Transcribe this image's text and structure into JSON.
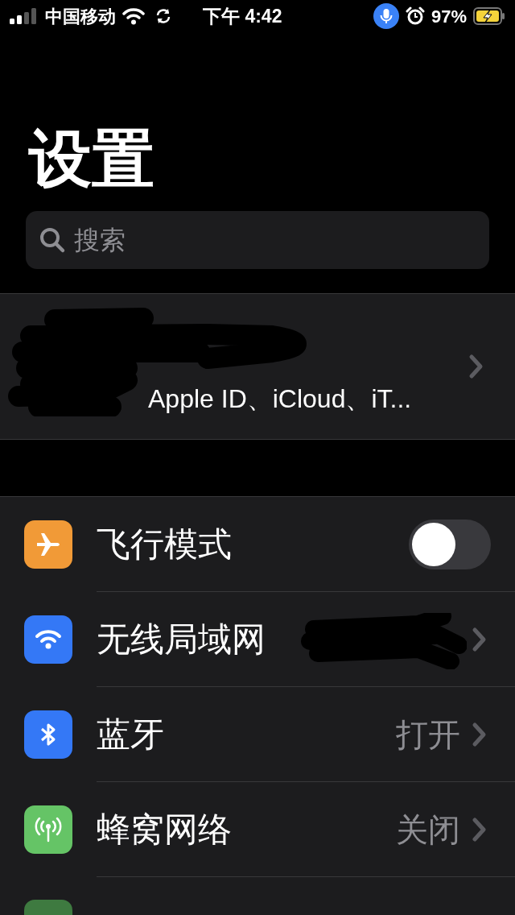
{
  "status_bar": {
    "carrier": "中国移动",
    "time": "下午 4:42",
    "battery": "97%",
    "charging": true
  },
  "title": "设置",
  "search": {
    "placeholder": "搜索"
  },
  "profile": {
    "subtitle": "Apple ID、iCloud、iT..."
  },
  "settings": [
    {
      "kind": "toggle",
      "label": "飞行模式",
      "on": false,
      "color": "#f19a37"
    },
    {
      "kind": "link",
      "label": "无线局域网",
      "color": "#3478f6"
    },
    {
      "kind": "link",
      "label": "蓝牙",
      "value": "打开",
      "color": "#3478f6"
    },
    {
      "kind": "link",
      "label": "蜂窝网络",
      "value": "关闭",
      "color": "#65c466"
    },
    {
      "kind": "partial",
      "color": "#3e7a40"
    }
  ]
}
